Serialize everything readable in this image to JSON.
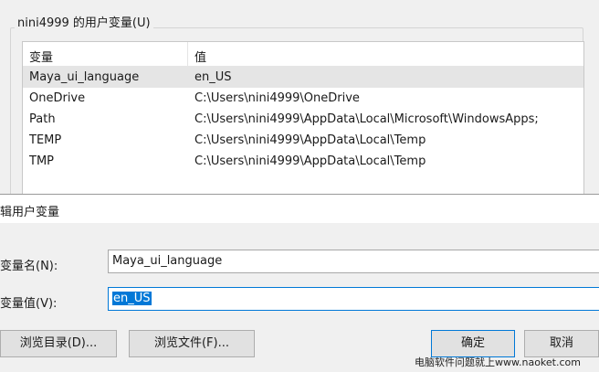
{
  "user_vars": {
    "group_title": "nini4999 的用户变量(U)",
    "columns": [
      "变量",
      "值"
    ],
    "rows": [
      {
        "name": "Maya_ui_language",
        "value": "en_US"
      },
      {
        "name": "OneDrive",
        "value": "C:\\Users\\nini4999\\OneDrive"
      },
      {
        "name": "Path",
        "value": "C:\\Users\\nini4999\\AppData\\Local\\Microsoft\\WindowsApps;"
      },
      {
        "name": "TEMP",
        "value": "C:\\Users\\nini4999\\AppData\\Local\\Temp"
      },
      {
        "name": "TMP",
        "value": "C:\\Users\\nini4999\\AppData\\Local\\Temp"
      }
    ]
  },
  "edit_dialog": {
    "title": "辑用户变量",
    "name_label": "变量名(N):",
    "name_value": "Maya_ui_language",
    "value_label": "变量值(V):",
    "value_value": "en_US",
    "browse_dir_label": "浏览目录(D)...",
    "browse_file_label": "浏览文件(F)...",
    "ok_label": "确定",
    "cancel_label": "取消"
  },
  "watermark": "电脑软件问题就上www.naoket.com"
}
